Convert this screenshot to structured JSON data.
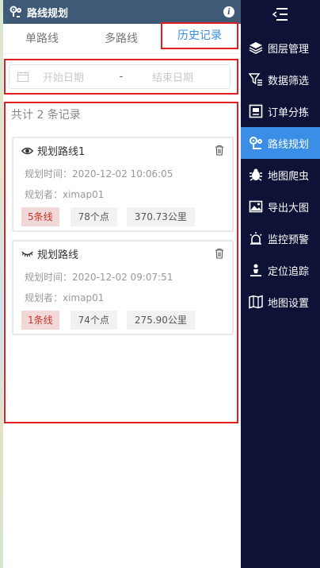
{
  "header": {
    "title": "路线规划",
    "info_icon": "i"
  },
  "tabs": [
    {
      "label": "单路线",
      "active": false
    },
    {
      "label": "多路线",
      "active": false
    },
    {
      "label": "历史记录",
      "active": true
    }
  ],
  "date_range": {
    "start_placeholder": "开始日期",
    "separator": "-",
    "end_placeholder": "结束日期"
  },
  "records": {
    "count_text": "共计 2 条记录",
    "items": [
      {
        "icon": "eye-open-icon",
        "title": "规划路线1",
        "time": "规划时间：2020-12-02 10:06:05",
        "planner": "规划者：ximap01",
        "tags": [
          "5条线",
          "78个点",
          "370.73公里"
        ]
      },
      {
        "icon": "eye-closed-icon",
        "title": "规划路线",
        "time": "规划时间：2020-12-02 09:07:51",
        "planner": "规划者：ximap01",
        "tags": [
          "1条线",
          "74个点",
          "275.90公里"
        ]
      }
    ]
  },
  "nav": {
    "items": [
      {
        "label": "图层管理",
        "icon": "layers-icon",
        "active": false
      },
      {
        "label": "数据筛选",
        "icon": "filter-icon",
        "active": false
      },
      {
        "label": "订单分拣",
        "icon": "sort-icon",
        "active": false
      },
      {
        "label": "路线规划",
        "icon": "route-icon",
        "active": true
      },
      {
        "label": "地图爬虫",
        "icon": "bug-icon",
        "active": false
      },
      {
        "label": "导出大图",
        "icon": "image-export-icon",
        "active": false
      },
      {
        "label": "监控预警",
        "icon": "alarm-icon",
        "active": false
      },
      {
        "label": "定位追踪",
        "icon": "locate-icon",
        "active": false
      },
      {
        "label": "地图设置",
        "icon": "map-settings-icon",
        "active": false
      }
    ]
  },
  "colors": {
    "accent": "#3a8ee6",
    "nav_bg": "#0d1236",
    "header_bg": "#3e5a77",
    "highlight": "#e02020"
  }
}
